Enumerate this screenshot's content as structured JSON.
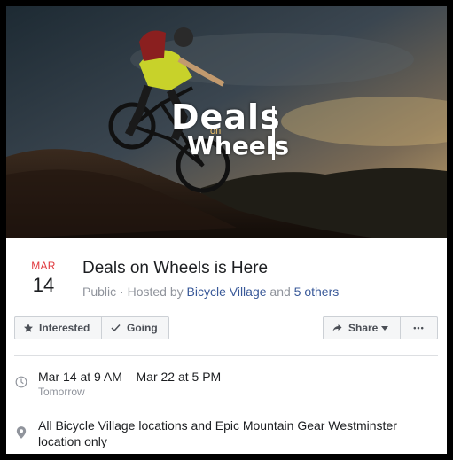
{
  "cover": {
    "logo_line1": "Deals",
    "logo_mid": "on",
    "logo_line2": "Wheels"
  },
  "event": {
    "month": "MAR",
    "day": "14",
    "title": "Deals on Wheels is Here",
    "privacy": "Public",
    "hosted_by_prefix": " · Hosted by ",
    "host": "Bicycle Village",
    "and_text": " and ",
    "others": "5 others"
  },
  "actions": {
    "interested_label": "Interested",
    "going_label": "Going",
    "share_label": "Share",
    "more_label": "•••"
  },
  "details": {
    "time_range": "Mar 14 at 9 AM – Mar 22 at 5 PM",
    "time_relative": "Tomorrow",
    "location": "All Bicycle Village locations and Epic Mountain Gear Westminster location only"
  },
  "colors": {
    "accent_red": "#e0393e",
    "link_blue": "#385898",
    "muted_text": "#90949c"
  },
  "icons": {
    "interested": "star-icon",
    "going": "check-icon",
    "share": "share-arrow-icon",
    "time": "clock-icon",
    "location": "map-pin-icon"
  }
}
